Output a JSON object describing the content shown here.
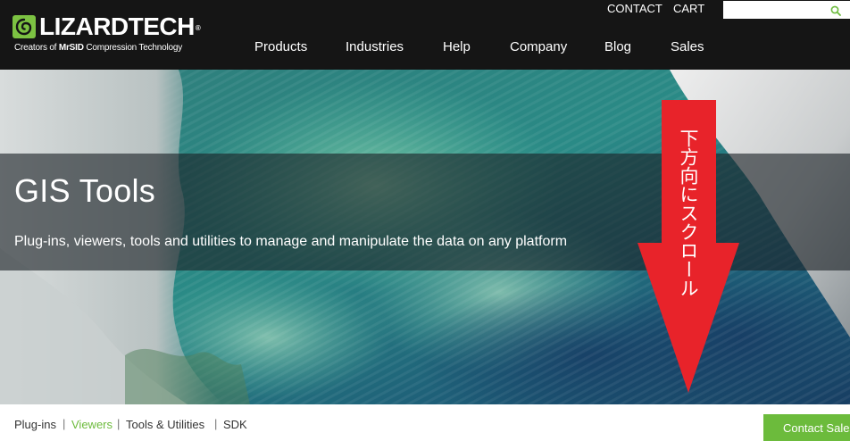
{
  "header": {
    "logo": {
      "wordmark": "LIZARDTECH",
      "trademark": "®",
      "tagline_prefix": "Creators of ",
      "tagline_brand": "MrSID",
      "tagline_suffix": " Compression Technology"
    },
    "utility_links": [
      "CONTACT",
      "CART"
    ],
    "search": {
      "value": "",
      "placeholder": ""
    },
    "nav": [
      "Products",
      "Industries",
      "Help",
      "Company",
      "Blog",
      "Sales"
    ]
  },
  "hero": {
    "title": "GIS Tools",
    "subtitle": "Plug-ins, viewers, tools and utilities to manage and manipulate the data on any platform",
    "annotation": "下方向にスクロール"
  },
  "subnav": {
    "items": [
      {
        "label": "Plug-ins",
        "active": false
      },
      {
        "label": "Viewers",
        "active": true
      },
      {
        "label": "Tools & Utilities",
        "active": false
      },
      {
        "label": "SDK",
        "active": false
      }
    ],
    "separator": "|",
    "cta": "Contact Sales"
  },
  "colors": {
    "header_bg": "#151515",
    "brand_green": "#6cbb3c",
    "annotation_red": "#e8232a"
  }
}
